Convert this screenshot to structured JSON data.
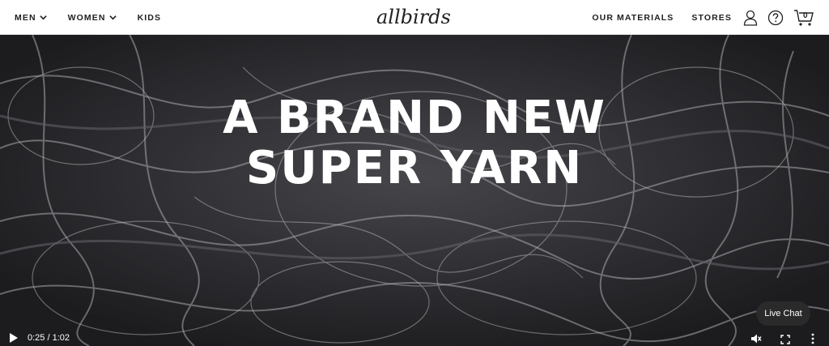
{
  "nav": {
    "left": [
      {
        "label": "MEN",
        "has_dropdown": true
      },
      {
        "label": "WOMEN",
        "has_dropdown": true
      },
      {
        "label": "KIDS",
        "has_dropdown": false
      }
    ],
    "logo_text": "allbirds",
    "right": [
      {
        "label": "OUR MATERIALS"
      },
      {
        "label": "STORES"
      }
    ],
    "icons": [
      "account-icon",
      "help-icon",
      "cart-icon"
    ],
    "cart_count": "0"
  },
  "hero": {
    "headline_line1": "A BRAND NEW",
    "headline_line2": "SUPER YARN",
    "video": {
      "time": "0:25 / 1:02",
      "progress": 0.4,
      "muted": true
    }
  },
  "live_chat": {
    "label": "Live Chat"
  },
  "colors": {
    "text_dark": "#212121",
    "headline": "#ffffff",
    "chat_bg": "#2a2a2a"
  }
}
